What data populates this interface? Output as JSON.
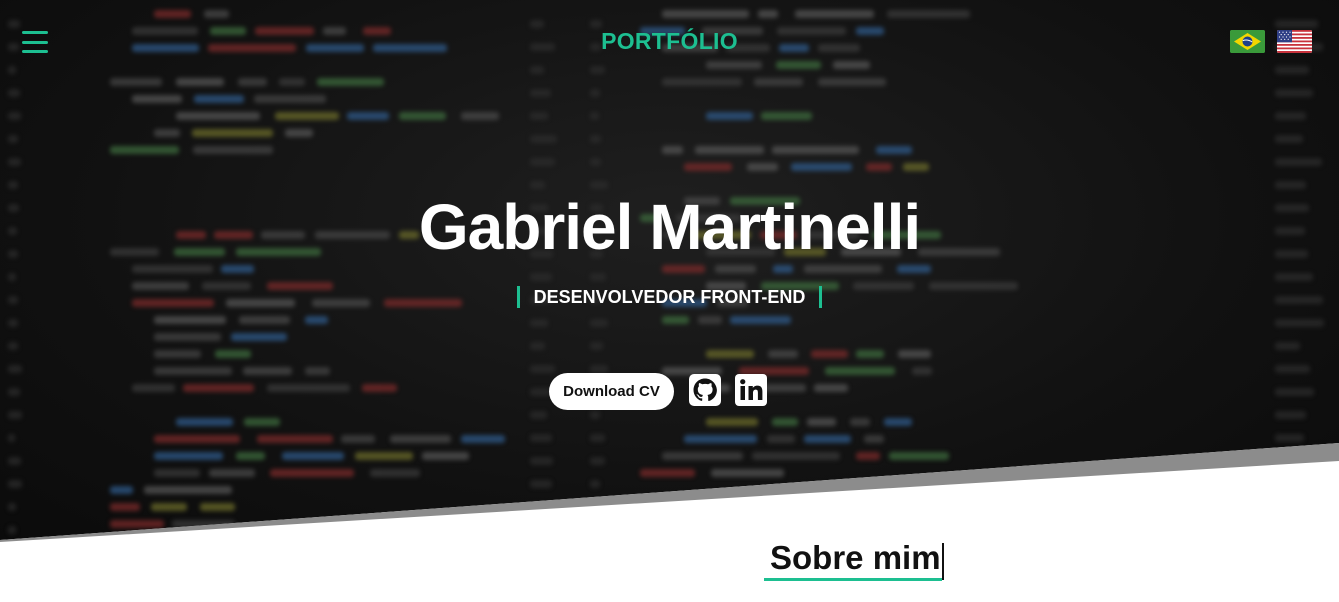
{
  "header": {
    "brand": "PORTFÓLIO",
    "menu_icon": "hamburger-menu-icon",
    "languages": [
      {
        "name": "Português",
        "icon": "brazil-flag-icon"
      },
      {
        "name": "English",
        "icon": "usa-flag-icon"
      }
    ]
  },
  "hero": {
    "name": "Gabriel Martinelli",
    "role": "DESENVOLVEDOR FRONT-END",
    "download_label": "Download CV",
    "social": [
      {
        "name": "GitHub",
        "icon": "github-icon"
      },
      {
        "name": "LinkedIn",
        "icon": "linkedin-icon"
      }
    ]
  },
  "about": {
    "title": "Sobre mim"
  },
  "colors": {
    "accent": "#1dbf91",
    "hero_bg": "#111111",
    "text_light": "#ffffff",
    "text_dark": "#111111"
  }
}
